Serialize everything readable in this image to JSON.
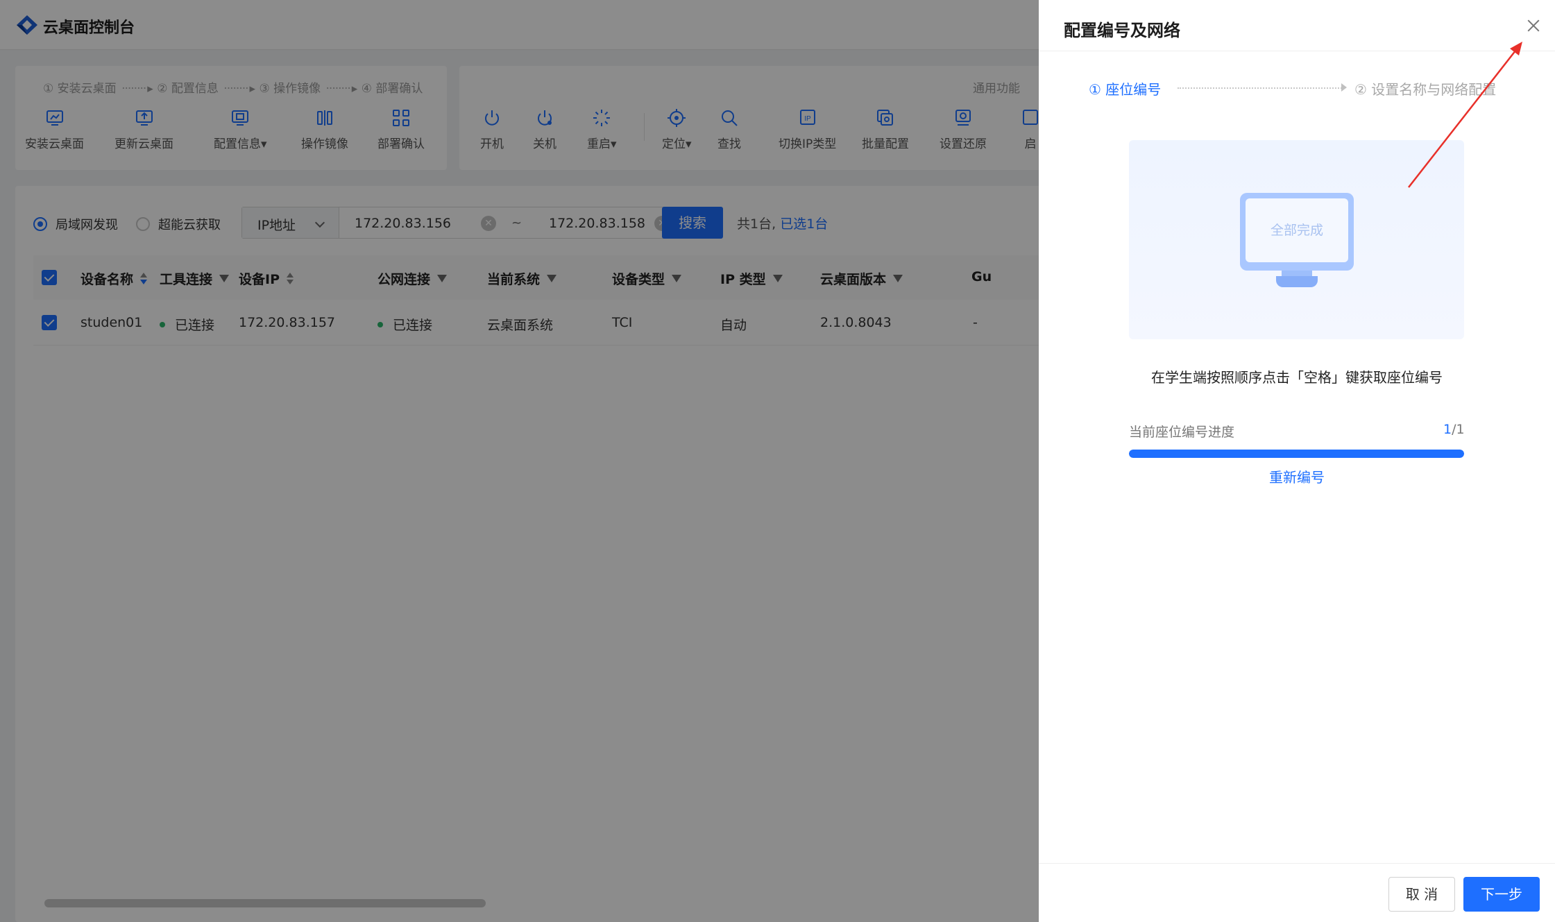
{
  "app": {
    "title": "云桌面控制台"
  },
  "wizard_steps": [
    {
      "label": "① 安装云桌面"
    },
    {
      "label": "② 配置信息"
    },
    {
      "label": "③ 操作镜像"
    },
    {
      "label": "④ 部署确认"
    }
  ],
  "dots": "········",
  "common_label": "通用功能",
  "toolbar_left": [
    {
      "label": "安装云桌面",
      "icon": "install-desktop-icon"
    },
    {
      "label": "更新云桌面",
      "icon": "update-desktop-icon"
    },
    {
      "label": "配置信息▾",
      "icon": "config-info-icon"
    },
    {
      "label": "操作镜像",
      "icon": "mirror-icon"
    },
    {
      "label": "部署确认",
      "icon": "deploy-confirm-icon"
    }
  ],
  "toolbar_right": [
    {
      "label": "开机",
      "icon": "power-on-icon"
    },
    {
      "label": "关机",
      "icon": "power-off-icon"
    },
    {
      "label": "重启▾",
      "icon": "restart-icon"
    },
    {
      "label": "定位▾",
      "icon": "locate-icon"
    },
    {
      "label": "查找",
      "icon": "search-icon"
    },
    {
      "label": "切换IP类型",
      "icon": "switch-ip-icon"
    },
    {
      "label": "批量配置",
      "icon": "batch-config-icon"
    },
    {
      "label": "设置还原",
      "icon": "restore-icon"
    },
    {
      "label": "启",
      "icon": "start-icon"
    }
  ],
  "discovery": {
    "options": [
      {
        "label": "局域网发现",
        "selected": true
      },
      {
        "label": "超能云获取",
        "selected": false
      }
    ],
    "ip_type": "IP地址",
    "ip_start": "172.20.83.156",
    "ip_sep": "~",
    "ip_end": "172.20.83.158",
    "clear_glyph": "✕",
    "search_label": "搜索",
    "count_text": "共1台,",
    "selected_text": "已选1台"
  },
  "table": {
    "columns": [
      "设备名称",
      "工具连接",
      "设备IP",
      "公网连接",
      "当前系统",
      "设备类型",
      "IP 类型",
      "云桌面版本",
      "Gu"
    ],
    "rows": [
      {
        "name": "studen01",
        "tool_conn": "已连接",
        "ip": "172.20.83.157",
        "public_conn": "已连接",
        "system": "云桌面系统",
        "device_type": "TCI",
        "ip_type": "自动",
        "version": "2.1.0.8043",
        "gu": "-"
      }
    ]
  },
  "drawer": {
    "title": "配置编号及网络",
    "step1": "① 座位编号",
    "step2": "② 设置名称与网络配置",
    "illustration_text": "全部完成",
    "instruction": "在学生端按照顺序点击「空格」键获取座位编号",
    "progress_label": "当前座位编号进度",
    "progress_current": "1",
    "progress_total": "/1",
    "progress_fraction": 1.0,
    "renumber_label": "重新编号",
    "cancel_label": "取 消",
    "next_label": "下一步"
  },
  "colors": {
    "primary": "#1e6fff",
    "connected": "#2bb66b",
    "annotation_arrow": "#e8302a"
  }
}
